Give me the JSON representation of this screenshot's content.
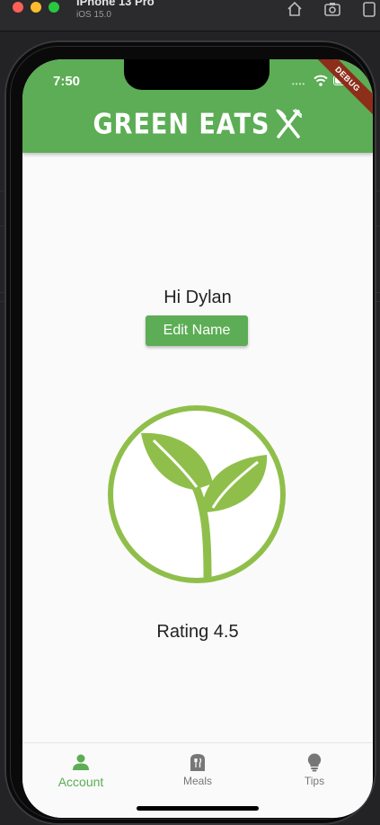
{
  "simulator": {
    "device_name": "iPhone 13 Pro",
    "os_version": "iOS 15.0",
    "tools": [
      "home-icon",
      "screenshot-icon",
      "rotate-icon"
    ]
  },
  "status_bar": {
    "time": "7:50",
    "debug_banner": "DEBUG"
  },
  "app_bar": {
    "logo_text": "GREEN EATS",
    "logo_icon": "fork-knife-icon",
    "color": "#5cad55"
  },
  "profile": {
    "greeting": "Hi Dylan",
    "edit_button_label": "Edit Name",
    "rating_text": "Rating 4.5",
    "logo_icon": "plant-sprout-icon"
  },
  "bottom_nav": {
    "items": [
      {
        "label": "Account",
        "icon": "person-icon",
        "active": true
      },
      {
        "label": "Meals",
        "icon": "meals-icon",
        "active": false
      },
      {
        "label": "Tips",
        "icon": "lightbulb-icon",
        "active": false
      }
    ]
  },
  "colors": {
    "accent": "#5cad55",
    "plant": "#8fbf4a",
    "background": "#fafafa"
  }
}
